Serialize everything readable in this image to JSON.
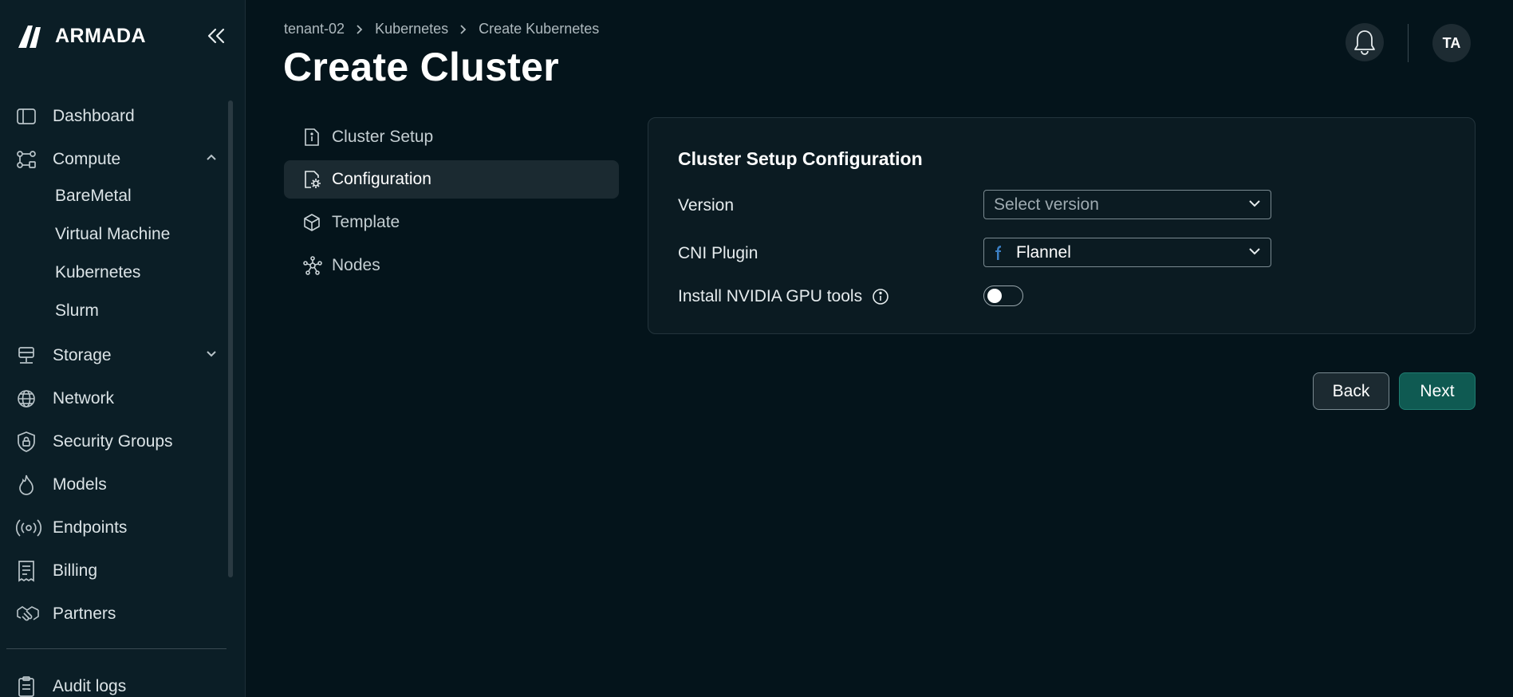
{
  "brand": {
    "name": "ARMADA",
    "logo_icon": "armada-logo"
  },
  "sidebar": {
    "collapse_icon": "double-chevron-left-icon",
    "items": [
      {
        "label": "Dashboard",
        "icon": "dashboard-icon"
      },
      {
        "label": "Compute",
        "icon": "compute-icon",
        "expanded": true,
        "children": [
          "BareMetal",
          "Virtual Machine",
          "Kubernetes",
          "Slurm"
        ]
      },
      {
        "label": "Storage",
        "icon": "storage-icon",
        "expanded": false
      },
      {
        "label": "Network",
        "icon": "globe-icon"
      },
      {
        "label": "Security Groups",
        "icon": "shield-lock-icon"
      },
      {
        "label": "Models",
        "icon": "flame-icon"
      },
      {
        "label": "Endpoints",
        "icon": "broadcast-icon"
      },
      {
        "label": "Billing",
        "icon": "receipt-icon"
      },
      {
        "label": "Partners",
        "icon": "handshake-icon"
      },
      {
        "label": "Audit logs",
        "icon": "clipboard-icon"
      }
    ]
  },
  "header": {
    "breadcrumb": [
      "tenant-02",
      "Kubernetes",
      "Create Kubernetes"
    ],
    "title": "Create Cluster",
    "avatar_initials": "TA",
    "bell_icon": "bell-icon"
  },
  "steps": [
    {
      "label": "Cluster Setup",
      "icon": "document-info-icon",
      "active": false
    },
    {
      "label": "Configuration",
      "icon": "document-gear-icon",
      "active": true
    },
    {
      "label": "Template",
      "icon": "cube-icon",
      "active": false
    },
    {
      "label": "Nodes",
      "icon": "nodes-icon",
      "active": false
    }
  ],
  "config": {
    "title": "Cluster Setup Configuration",
    "version": {
      "label": "Version",
      "placeholder": "Select version",
      "value": ""
    },
    "cni": {
      "label": "CNI Plugin",
      "value": "Flannel",
      "icon": "flannel-icon"
    },
    "gpu_tools": {
      "label": "Install NVIDIA GPU tools",
      "enabled": false,
      "info_icon": "info-circle-icon"
    }
  },
  "actions": {
    "back_label": "Back",
    "next_label": "Next"
  },
  "colors": {
    "background": "#04141b",
    "sidebar": "#0b1e26",
    "primary_button": "#0f5a52",
    "card": "#0b1b22"
  }
}
